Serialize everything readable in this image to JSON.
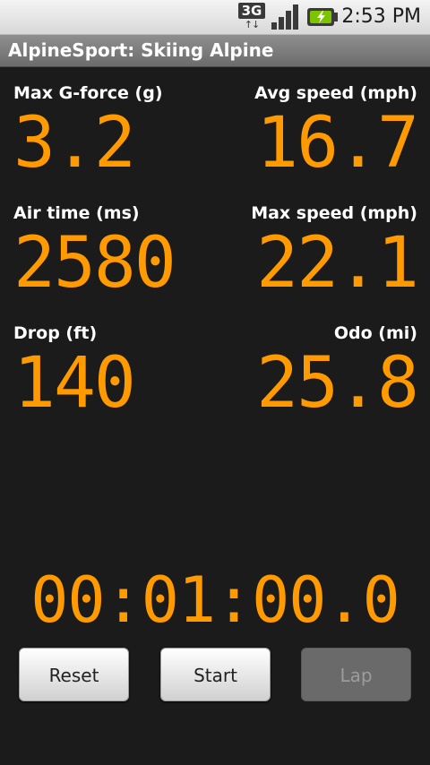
{
  "status_bar": {
    "network_label": "3G",
    "network_icon": "3g-data-icon",
    "signal_icon": "signal-strength-icon",
    "battery_icon": "battery-charging-icon",
    "time": "2:53 PM"
  },
  "title_bar": {
    "title": "AlpineSport: Skiing Alpine"
  },
  "stats": {
    "max_g": {
      "label": "Max G-force (g)",
      "value": "3.2"
    },
    "avg_speed": {
      "label": "Avg speed (mph)",
      "value": "16.7"
    },
    "air_time": {
      "label": "Air time (ms)",
      "value": "2580"
    },
    "max_speed": {
      "label": "Max speed (mph)",
      "value": "22.1"
    },
    "drop": {
      "label": "Drop (ft)",
      "value": "140"
    },
    "odo": {
      "label": "Odo (mi)",
      "value": "25.8"
    }
  },
  "timer": {
    "value": "00:01:00.0"
  },
  "buttons": {
    "reset": "Reset",
    "start": "Start",
    "lap": "Lap",
    "lap_enabled": false
  },
  "colors": {
    "accent": "#ff9a00",
    "background": "#1b1b1b",
    "label": "#ffffff"
  }
}
